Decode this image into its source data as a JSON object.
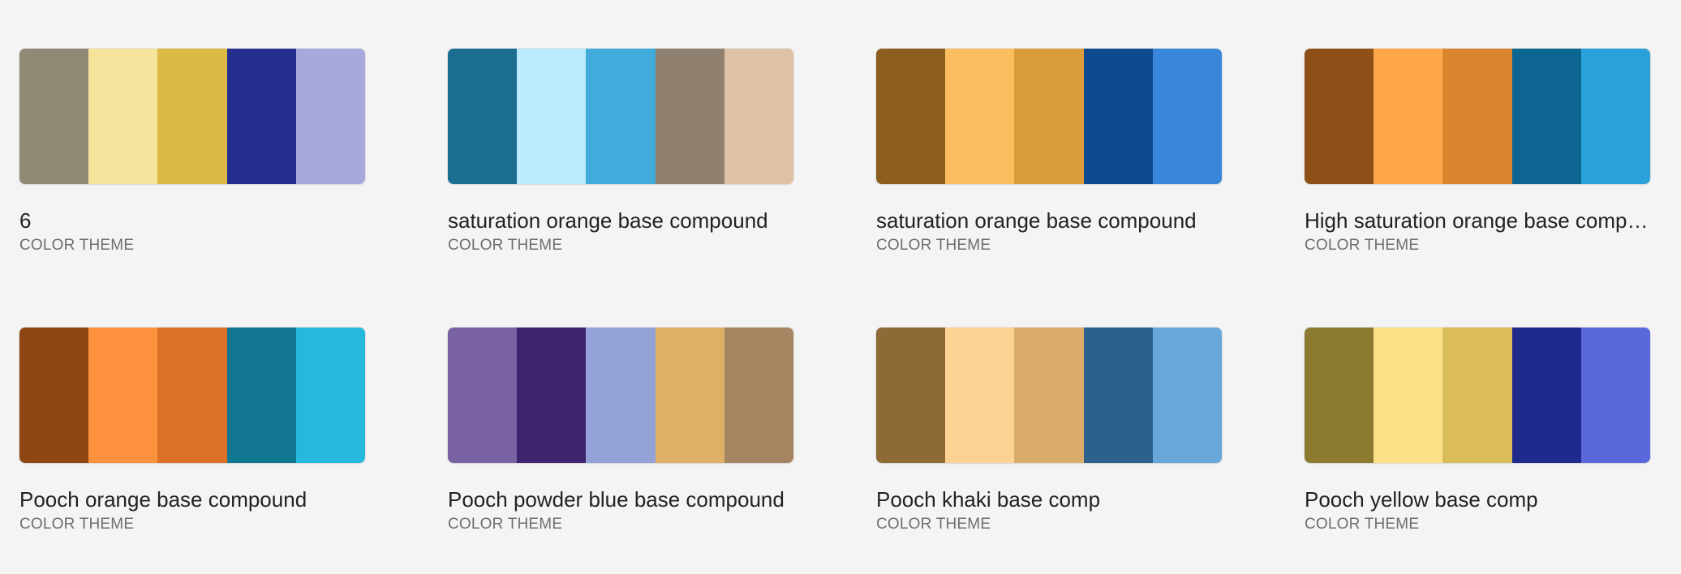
{
  "themes": [
    {
      "title": "6",
      "type_label": "COLOR THEME",
      "colors": [
        "#8f8a76",
        "#f6e39c",
        "#dbba45",
        "#242e8f",
        "#a7a8db"
      ]
    },
    {
      "title": "saturation orange base compound",
      "type_label": "COLOR THEME",
      "colors": [
        "#1c6e91",
        "#bceafd",
        "#41abdc",
        "#8f806f",
        "#dec2a6"
      ]
    },
    {
      "title": "saturation orange base compound",
      "type_label": "COLOR THEME",
      "colors": [
        "#8b5e1e",
        "#fdbe5f",
        "#db9c3c",
        "#0d4b8e",
        "#3987db"
      ]
    },
    {
      "title": "High saturation orange base compound",
      "type_label": "COLOR THEME",
      "colors": [
        "#8e5016",
        "#fea84b",
        "#da862e",
        "#0d6592",
        "#2ba1da"
      ]
    },
    {
      "title": "Pooch orange base compound",
      "type_label": "COLOR THEME",
      "colors": [
        "#8d4614",
        "#fe923f",
        "#db7027",
        "#117791",
        "#26b9dd"
      ]
    },
    {
      "title": "Pooch powder blue base compound",
      "type_label": "COLOR THEME",
      "colors": [
        "#7962a3",
        "#3e236f",
        "#95a2d7",
        "#deb067",
        "#a68563"
      ]
    },
    {
      "title": "Pooch khaki base comp",
      "type_label": "COLOR THEME",
      "colors": [
        "#8e6a37",
        "#fed293",
        "#daac6c",
        "#2c618d",
        "#68a8d9"
      ]
    },
    {
      "title": "Pooch yellow base comp",
      "type_label": "COLOR THEME",
      "colors": [
        "#8d7a31",
        "#fde186",
        "#dbbc5b",
        "#1f2a8d",
        "#5a68dc"
      ]
    }
  ]
}
